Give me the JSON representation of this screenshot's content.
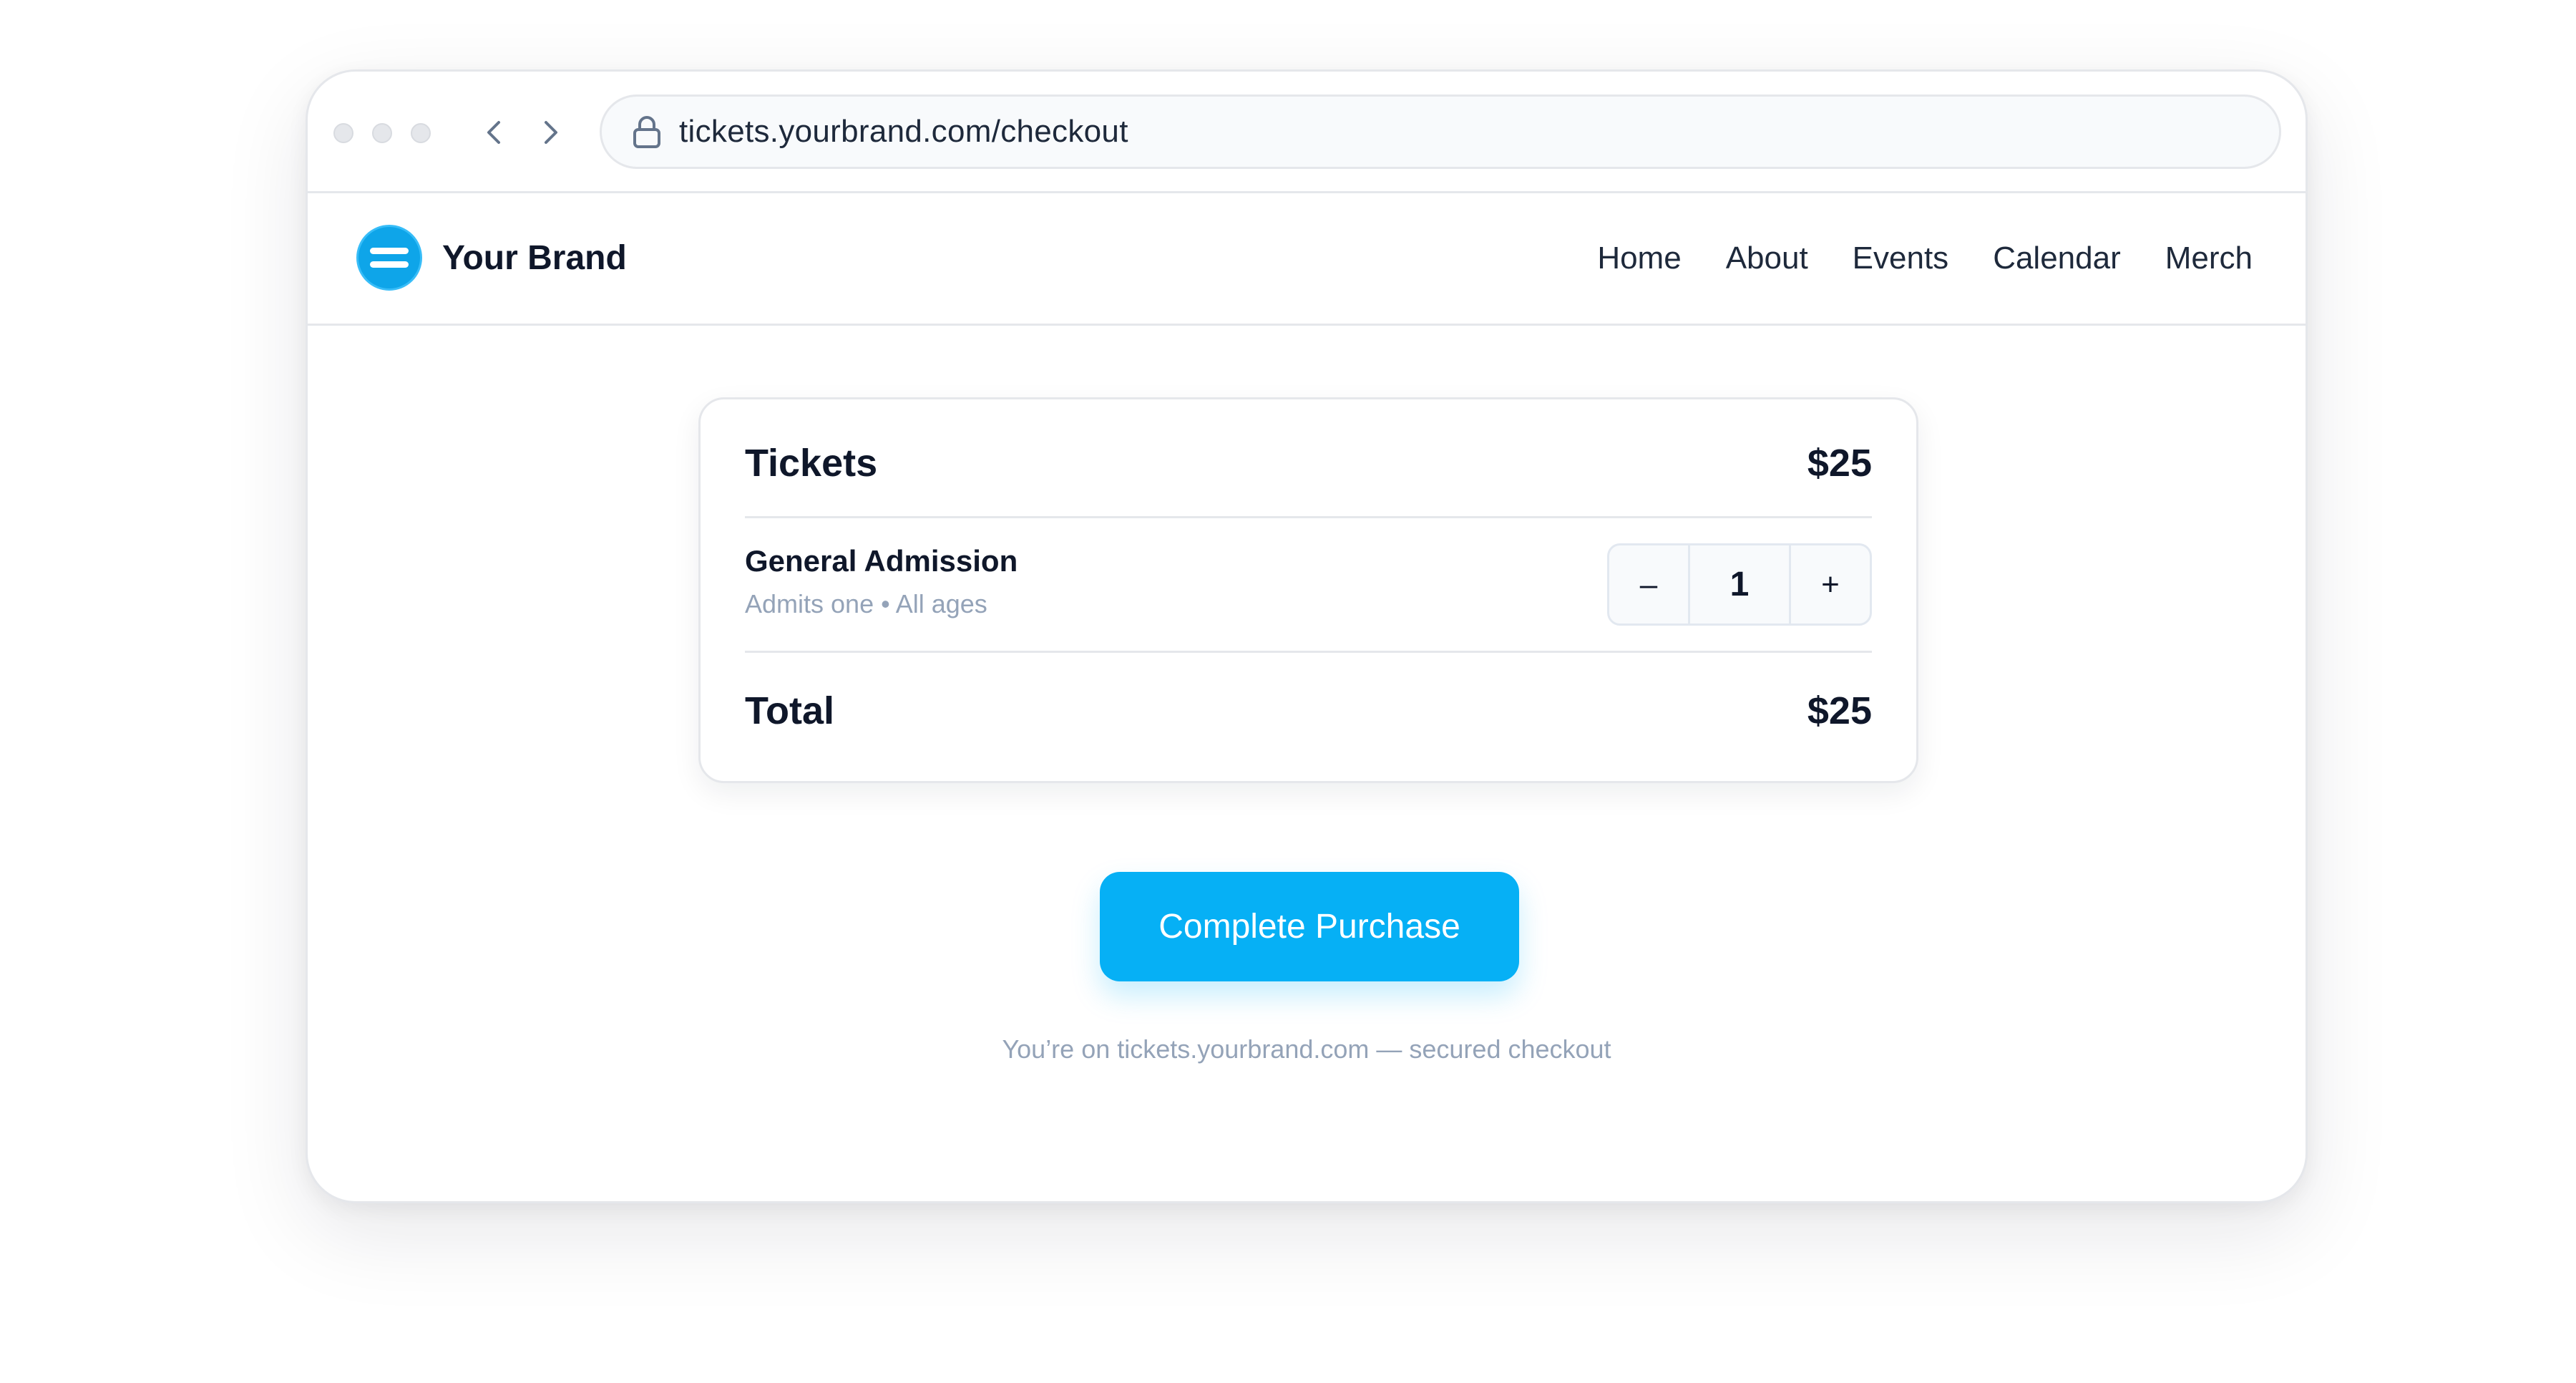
{
  "browser": {
    "url": "tickets.yourbrand.com/checkout",
    "back_icon": "chevron-left-icon",
    "forward_icon": "chevron-right-icon",
    "lock_icon": "lock-icon"
  },
  "header": {
    "brand_name": "Your Brand",
    "brand_color": "#0ea5e9",
    "nav": [
      "Home",
      "About",
      "Events",
      "Calendar",
      "Merch"
    ]
  },
  "cart": {
    "title": "Tickets",
    "title_price": "$25",
    "item": {
      "name": "General Admission",
      "description": "Admits one • All ages",
      "decrement_label": "–",
      "quantity": "1",
      "increment_label": "+"
    },
    "total_label": "Total",
    "total_value": "$25"
  },
  "actions": {
    "purchase_label": "Complete Purchase",
    "accent_color": "#06b0f5"
  },
  "footer_note": "You’re on tickets.yourbrand.com — secured checkout"
}
